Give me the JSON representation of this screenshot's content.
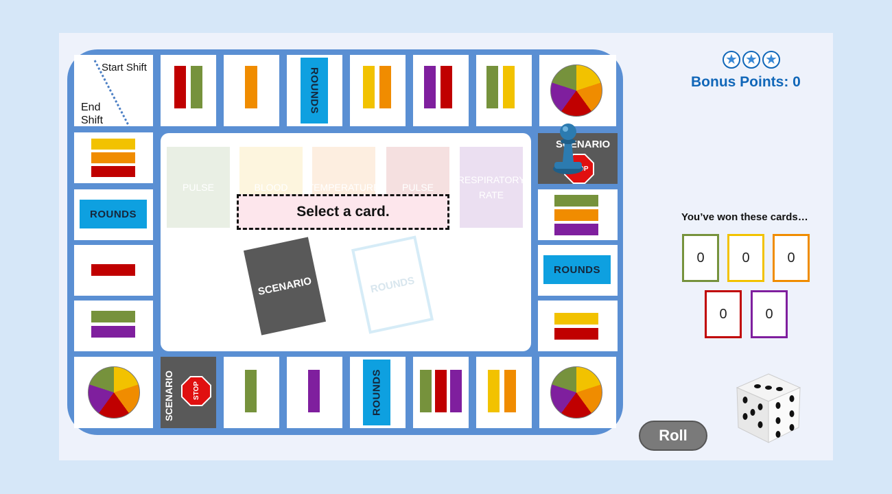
{
  "board": {
    "start_label": "Start Shift",
    "end_label_1": "End",
    "end_label_2": "Shift",
    "rounds_label": "ROUNDS",
    "scenario_label": "SCENARIO",
    "stop_label": "STOP"
  },
  "center": {
    "prompt": "Select a card.",
    "vital_cards": [
      "PULSE",
      "BLOOD",
      "TEMPERATURE",
      "PULSE",
      "RESPIRATORY RATE"
    ],
    "scenario_deck": "SCENARIO",
    "rounds_deck": "ROUNDS"
  },
  "sidebar": {
    "bonus_label": "Bonus Points: 0",
    "won_title": "You’ve won these cards…",
    "won_counts": [
      "0",
      "0",
      "0",
      "0",
      "0"
    ],
    "roll_label": "Roll"
  },
  "colors": {
    "red": "#c00000",
    "green": "#76923c",
    "orange": "#f08c00",
    "yellow": "#f2c200",
    "purple": "#7f1f9e",
    "blue_card": "#0ea0e0",
    "board_blue": "#5a8fd3"
  },
  "icons": [
    "star-icon",
    "pawn-icon",
    "die-icon",
    "stop-sign-icon",
    "category-pie-icon"
  ]
}
